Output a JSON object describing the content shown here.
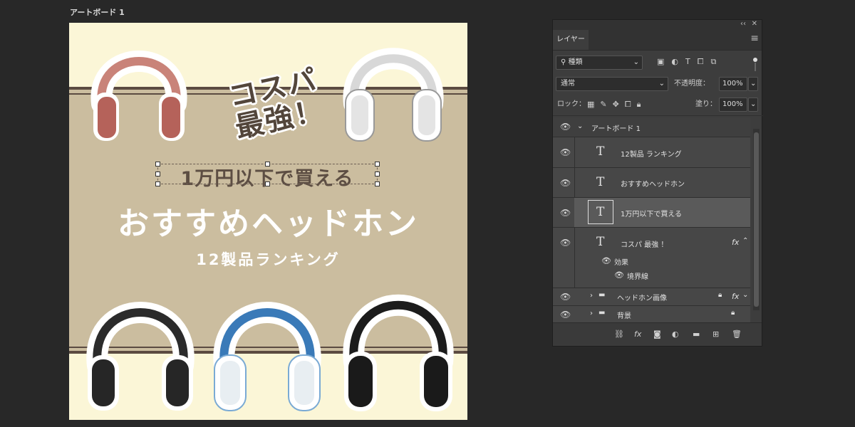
{
  "artboard": {
    "title": "アートボード 1",
    "tag_line1": "コスパ",
    "tag_line2": "最強！",
    "subtitle": "1万円以下で買える",
    "main_title": "おすすめヘッドホン",
    "ranking": "12製品ランキング"
  },
  "panel": {
    "collapse_glyph": "‹‹",
    "close_glyph": "✕",
    "menu_glyph": "≡",
    "tab_layers": "レイヤー",
    "filter_kind": "種類",
    "blend_mode": "通常",
    "opacity_label": "不透明度：",
    "opacity_value": "100%",
    "lock_label": "ロック：",
    "fill_label": "塗り：",
    "fill_value": "100%",
    "group_artboard": "アートボード 1",
    "layers": [
      {
        "name": "12製品 ランキング",
        "type": "T"
      },
      {
        "name": "おすすめヘッドホン",
        "type": "T"
      },
      {
        "name": "1万円以下で買える",
        "type": "T"
      },
      {
        "name": "コスパ  最強 ！",
        "type": "T"
      }
    ],
    "effects_label": "効果",
    "stroke_label": "境界線",
    "fx": "fx",
    "group_headphones": "ヘッドホン画像",
    "group_background": "背景"
  },
  "colors": {
    "artboard_bg": "#cbbd9f",
    "cream": "#fbf6d7",
    "band": "#5b4b41",
    "panel_bg": "#3d3d3d",
    "selected_row": "#535353"
  }
}
